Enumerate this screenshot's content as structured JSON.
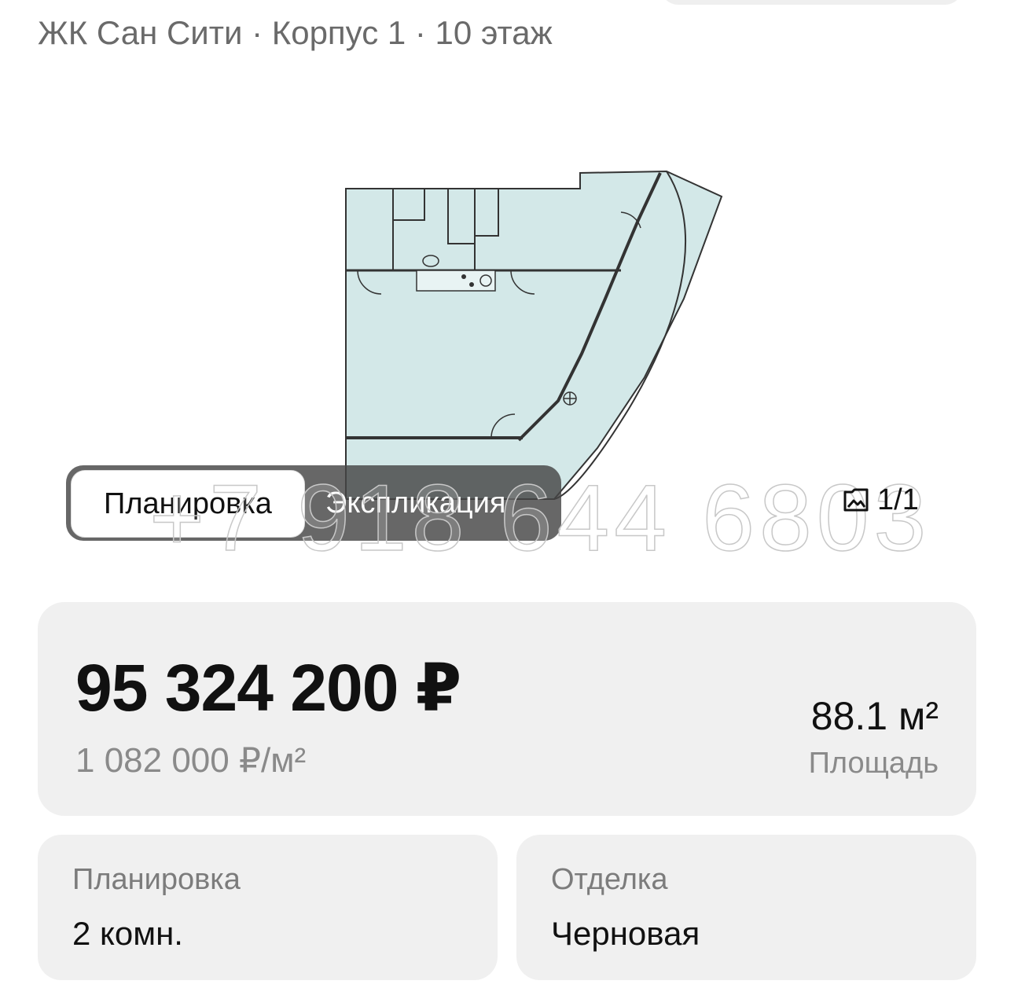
{
  "header": {
    "subtitle": "ЖК Сан Сити · Корпус 1 · 10 этаж"
  },
  "plan": {
    "fill_color": "#d3e8e8",
    "line_color": "#333333"
  },
  "watermark": "+7 918 644 6803",
  "tabs": {
    "active_label": "Планировка",
    "inactive_label": "Экспликация"
  },
  "gallery": {
    "icon": "image-gallery-icon",
    "counter": "1/1"
  },
  "price_card": {
    "price": "95 324 200 ₽",
    "price_per_m2": "1 082 000 ₽/м²",
    "area_value": "88.1 м²",
    "area_label": "Площадь"
  },
  "layout_card": {
    "label": "Планировка",
    "value": "2 комн."
  },
  "finish_card": {
    "label": "Отделка",
    "value": "Черновая"
  }
}
